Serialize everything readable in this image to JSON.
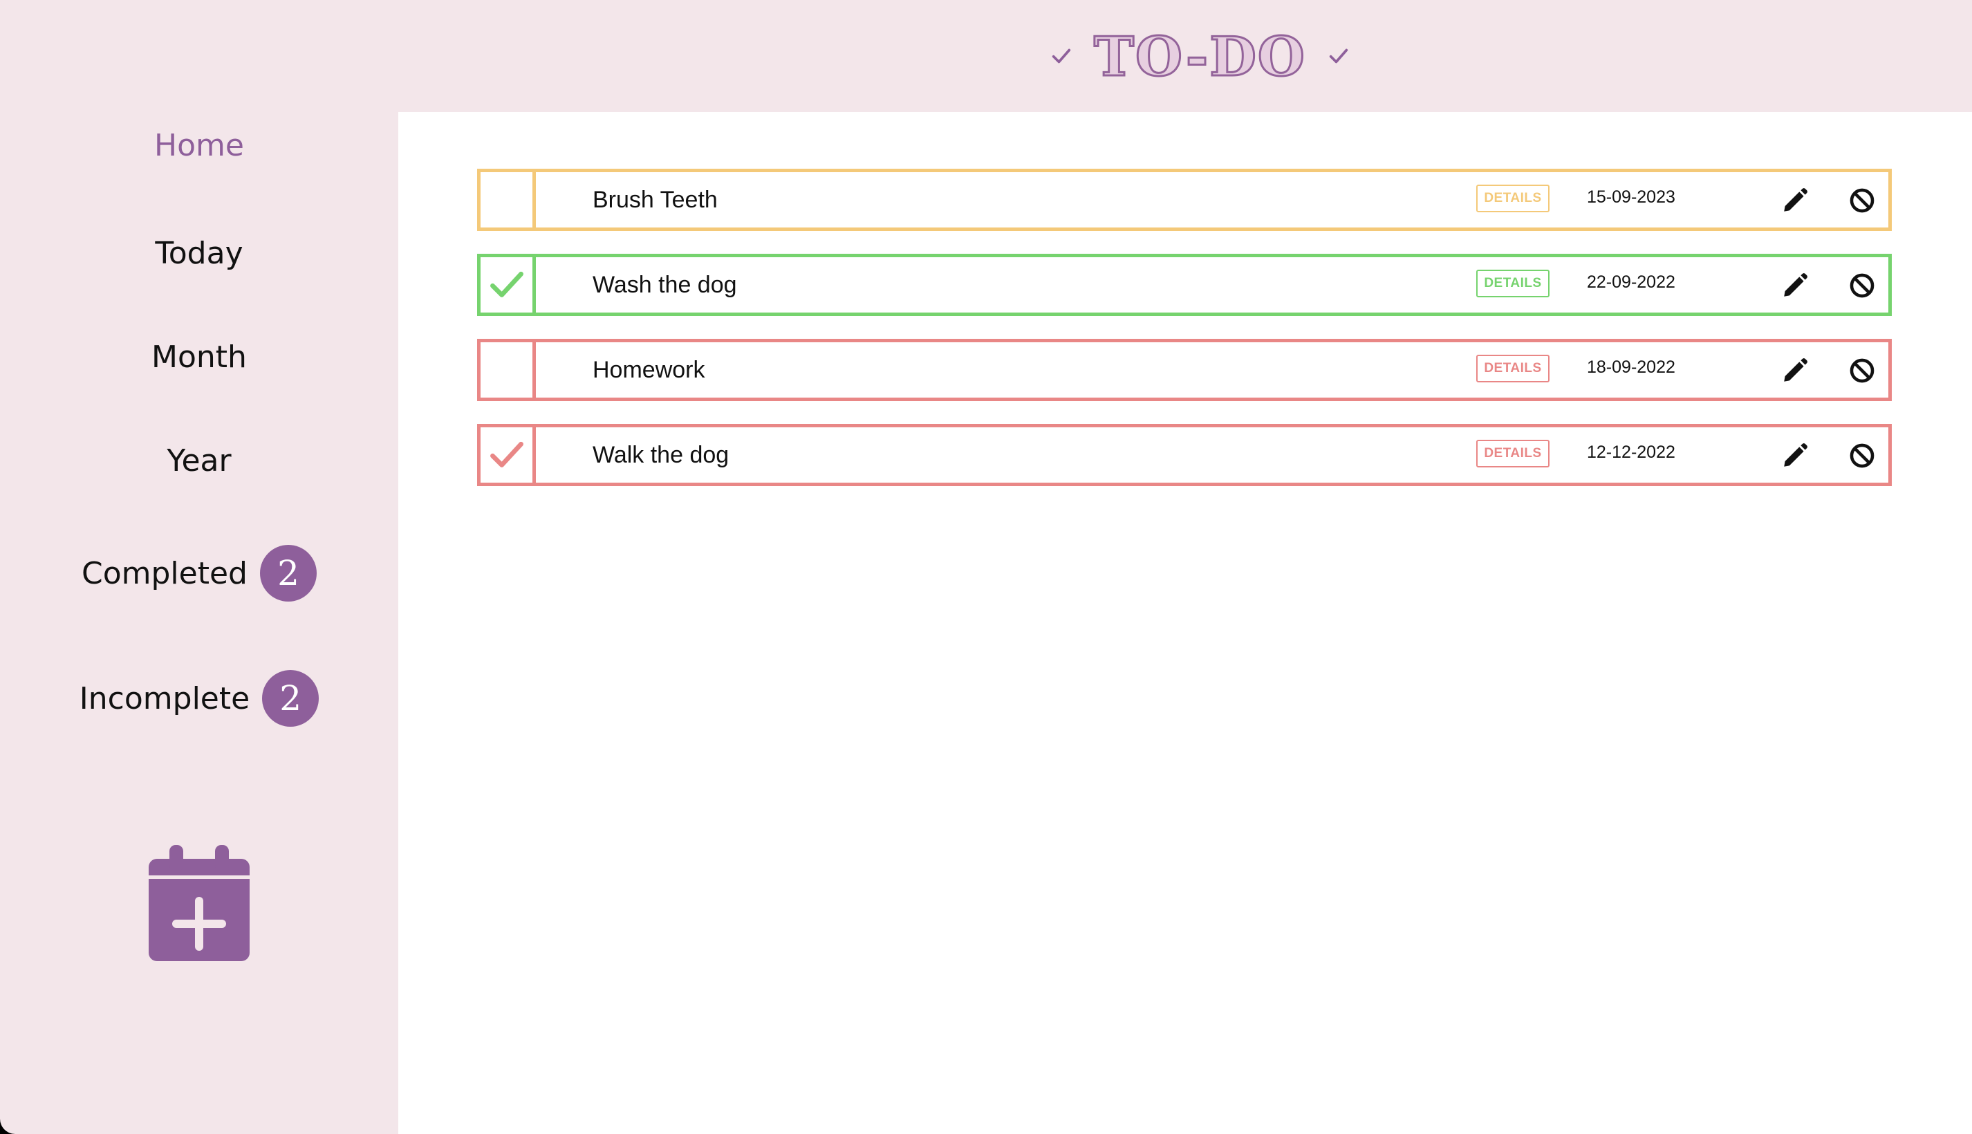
{
  "header": {
    "title": "TO-DO"
  },
  "sidebar": {
    "items": [
      {
        "label": "Home"
      },
      {
        "label": "Today"
      },
      {
        "label": "Month"
      },
      {
        "label": "Year"
      },
      {
        "label": "Completed",
        "count": "2"
      },
      {
        "label": "Incomplete",
        "count": "2"
      }
    ],
    "add_icon": "calendar-plus-icon"
  },
  "tasks": [
    {
      "title": "Brush Teeth",
      "details_label": "DETAILS",
      "date": "15-09-2023",
      "completed": false,
      "status_color": "#f4c979"
    },
    {
      "title": "Wash the dog",
      "details_label": "DETAILS",
      "date": "22-09-2022",
      "completed": true,
      "status_color": "#76d36e"
    },
    {
      "title": "Homework",
      "details_label": "DETAILS",
      "date": "18-09-2022",
      "completed": false,
      "status_color": "#e98786"
    },
    {
      "title": "Walk the dog",
      "details_label": "DETAILS",
      "date": "12-12-2022",
      "completed": true,
      "status_color": "#e98786"
    }
  ],
  "colors": {
    "accent": "#8e5f9b",
    "sidebar_bg": "#f3e6ea",
    "main_bg": "#ffffff",
    "pending": "#f4c979",
    "done": "#76d36e",
    "overdue": "#e98786"
  }
}
